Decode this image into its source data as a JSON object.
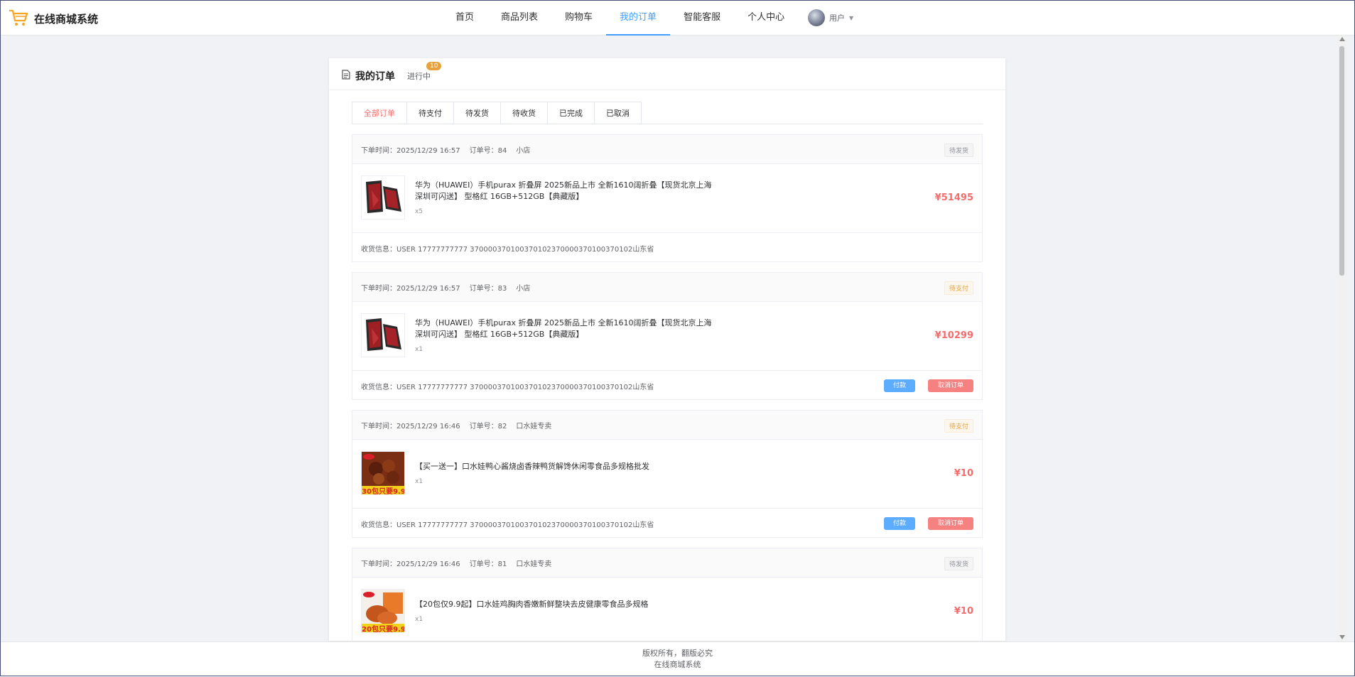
{
  "header": {
    "brand": "在线商城系统",
    "nav": [
      "首页",
      "商品列表",
      "购物车",
      "我的订单",
      "智能客服",
      "个人中心"
    ],
    "active_nav": "我的订单",
    "user_label": "用户"
  },
  "card": {
    "title": "我的订单",
    "subtitle": "进行中",
    "badge": "10",
    "tabs": [
      "全部订单",
      "待支付",
      "待发货",
      "待收货",
      "已完成",
      "已取消"
    ],
    "active_tab": "全部订单"
  },
  "orders": [
    {
      "time": "下单时间：2025/12/29 16:57",
      "order_no": "订单号：84",
      "shop": "小店",
      "status": "待发货",
      "product": "华为（HUAWEI）手机purax 折叠屏 2025新品上市 全新1610阔折叠【现货北京上海深圳可闪送】 型格红 16GB+512GB【典藏版】",
      "qty": "x5",
      "price": "¥51495",
      "address": "收货信息：USER 17777777777 370000370100370102370000370100370102山东省"
    },
    {
      "time": "下单时间：2025/12/29 16:57",
      "order_no": "订单号：83",
      "shop": "小店",
      "status": "待支付",
      "product": "华为（HUAWEI）手机purax 折叠屏 2025新品上市 全新1610阔折叠【现货北京上海深圳可闪送】 型格红 16GB+512GB【典藏版】",
      "qty": "x1",
      "price": "¥10299",
      "address": "收货信息：USER 17777777777 370000370100370102370000370100370102山东省",
      "pay_label": "付款",
      "cancel_label": "取消订单"
    },
    {
      "time": "下单时间：2025/12/29 16:46",
      "order_no": "订单号：82",
      "shop": "口水娃专卖",
      "status": "待支付",
      "product": "【买一送一】口水娃鸭心酱烧卤香辣鸭货解馋休闲零食品多规格批发",
      "qty": "x1",
      "price": "¥10",
      "thumb_text": "30包只要9.9",
      "address": "收货信息：USER 17777777777 370000370100370102370000370100370102山东省",
      "pay_label": "付款",
      "cancel_label": "取消订单"
    },
    {
      "time": "下单时间：2025/12/29 16:46",
      "order_no": "订单号：81",
      "shop": "口水娃专卖",
      "status": "待发货",
      "product": "【20包仅9.9起】口水娃鸡胸肉香嫩新鲜整块去皮健康零食品多规格",
      "qty": "x1",
      "price": "¥10",
      "thumb_text": "20包只要9.9"
    }
  ],
  "footer": {
    "line1": "版权所有，翻版必究",
    "line2": "在线商城系统"
  },
  "colors": {
    "accent": "#409eff",
    "price": "#f56c6c",
    "warning": "#e6a23c",
    "brand_cart": "#f5a623"
  }
}
